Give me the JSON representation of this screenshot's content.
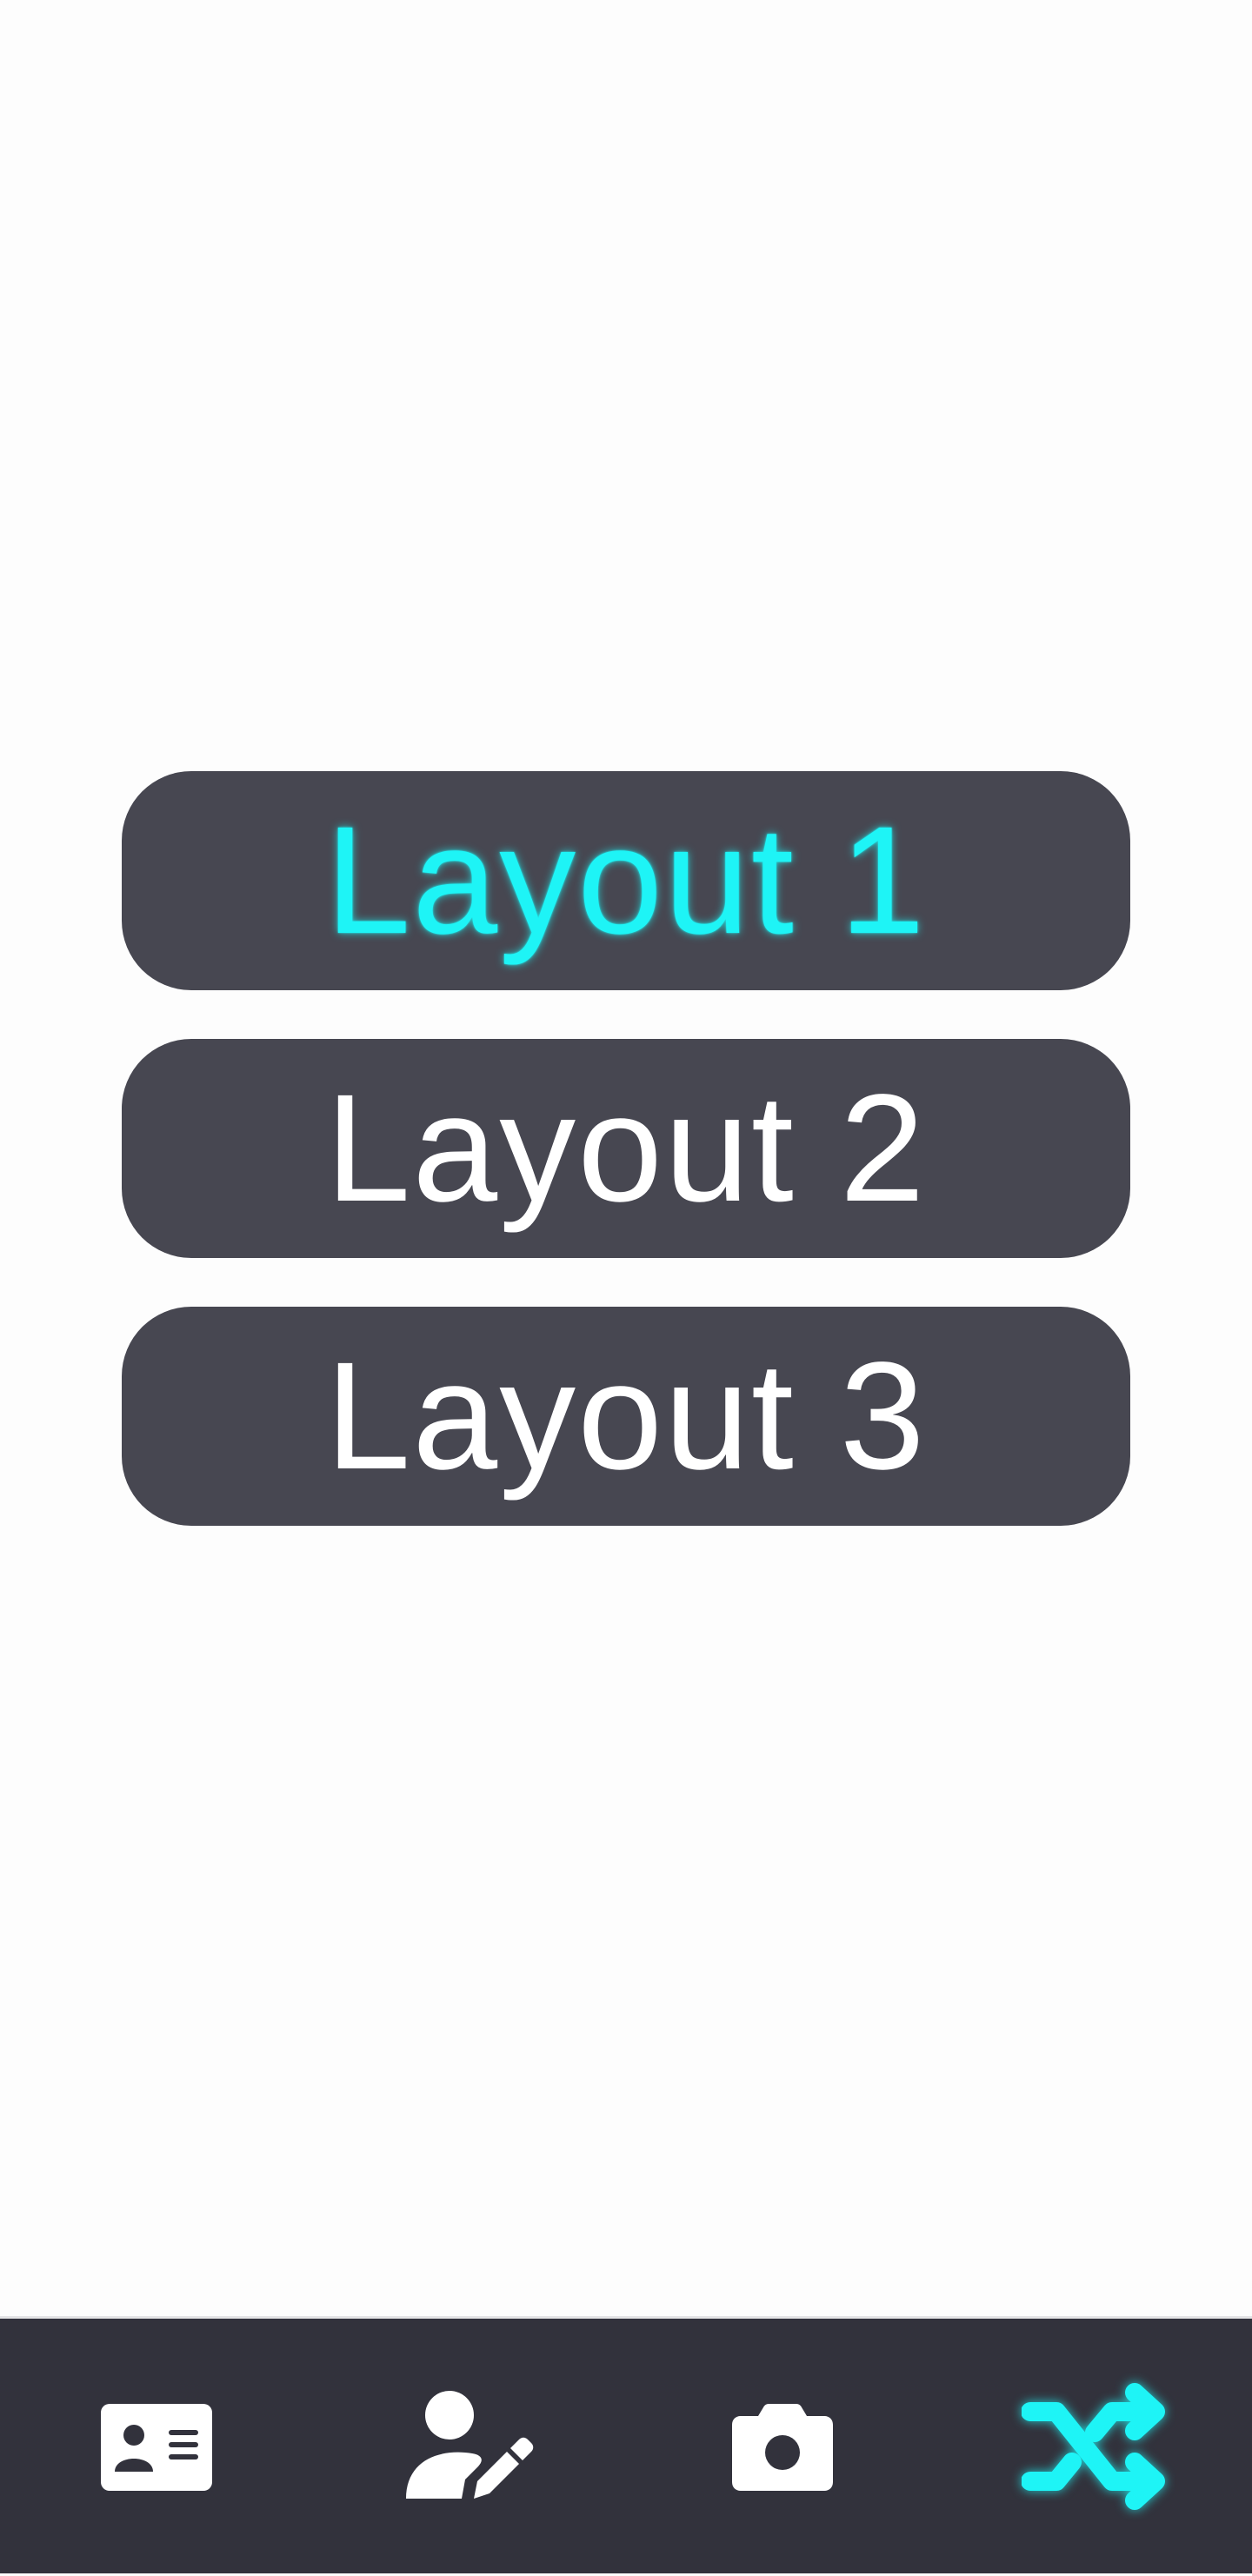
{
  "layouts": {
    "items": [
      {
        "label": "Layout 1",
        "selected": true
      },
      {
        "label": "Layout 2",
        "selected": false
      },
      {
        "label": "Layout 3",
        "selected": false
      }
    ]
  },
  "bottom_nav": {
    "items": [
      {
        "icon": "contact-card-icon",
        "selected": false
      },
      {
        "icon": "user-edit-icon",
        "selected": false
      },
      {
        "icon": "camera-icon",
        "selected": false
      },
      {
        "icon": "shuffle-icon",
        "selected": true
      }
    ]
  },
  "colors": {
    "page_background": "#fdfdfd",
    "button_background": "#474751",
    "button_text": "#ffffff",
    "accent": "#1ef4f6",
    "nav_background": "#32323c",
    "nav_icon": "#ffffff"
  }
}
